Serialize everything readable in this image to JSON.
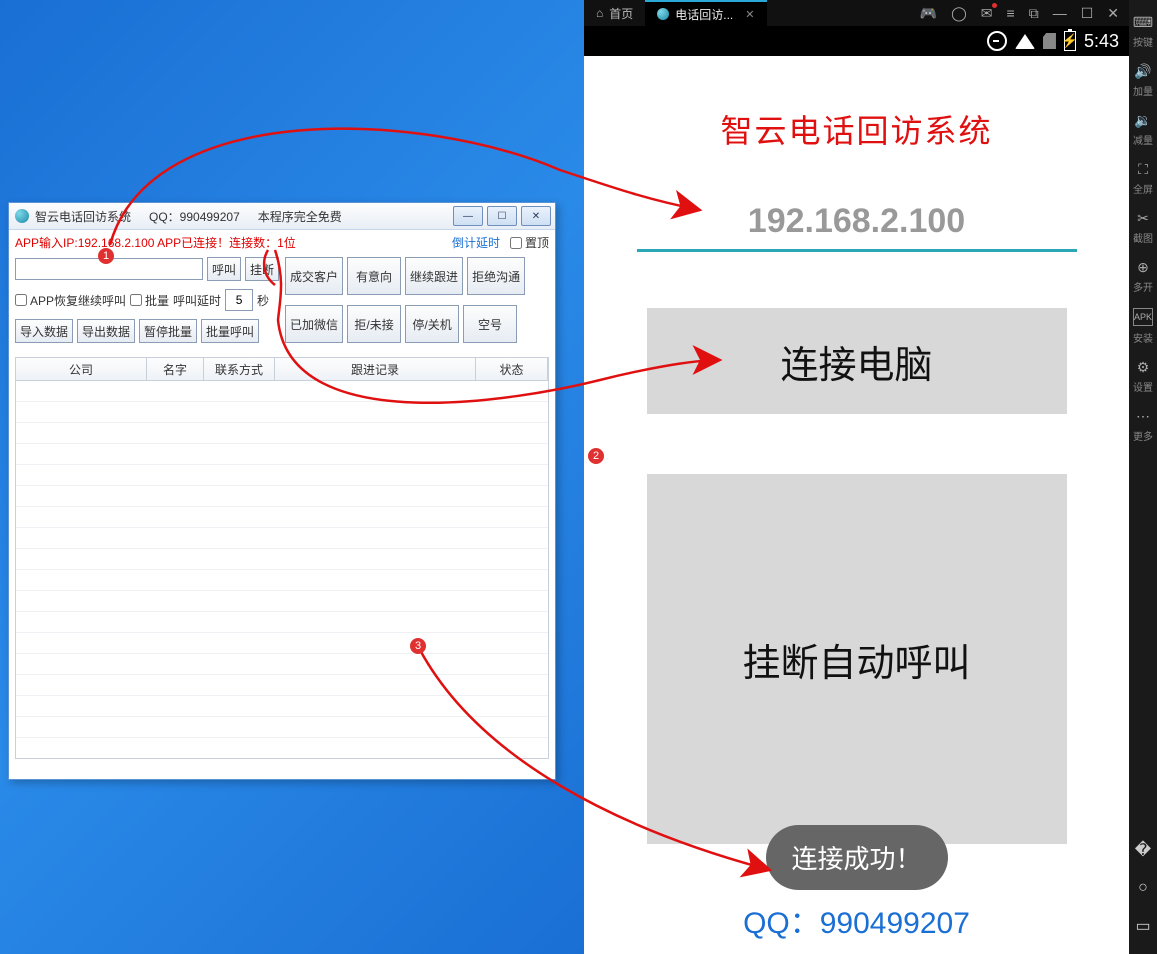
{
  "win": {
    "title_app": "智云电话回访系统",
    "title_qq": "QQ：990499207",
    "title_free": "本程序完全免费",
    "status_prefix": "APP输入IP:",
    "status_ip": "192.168.2.100",
    "status_connected": " APP已连接！连接数：",
    "status_count": "1位",
    "countdown": "倒计延时",
    "pin_top": "置顶",
    "btn_call": "呼叫",
    "btn_hang": "挂断",
    "chk_resume": "APP恢复继续呼叫",
    "chk_batch": "批量",
    "lbl_delay": "呼叫延时",
    "delay_val": "5",
    "lbl_sec": "秒",
    "btn_import": "导入数据",
    "btn_export": "导出数据",
    "btn_pause": "暂停批量",
    "btn_batchcall": "批量呼叫",
    "btn_deal": "成交客户",
    "btn_intent": "有意向",
    "btn_follow": "继续跟进",
    "btn_refuse": "拒绝沟通",
    "btn_wechat": "已加微信",
    "btn_miss": "拒/未接",
    "btn_off": "停/关机",
    "btn_empty": "空号",
    "cols": {
      "company": "公司",
      "name": "名字",
      "contact": "联系方式",
      "log": "跟进记录",
      "status": "状态"
    }
  },
  "emu": {
    "tab_home": "首页",
    "tab_app": "电话回访...",
    "time": "5:43",
    "app_title": "智云电话回访系统",
    "ip": "192.168.2.100",
    "btn_connect": "连接电脑",
    "btn_auto": "挂断自动呼叫",
    "toast": "连接成功！",
    "qq": "QQ：990499207"
  },
  "rtool": {
    "keys": "按键",
    "volup": "加量",
    "voldn": "减量",
    "full": "全屏",
    "shot": "截图",
    "multi": "多开",
    "apk": "安装",
    "set": "设置",
    "more": "更多"
  },
  "badges": {
    "b1": "1",
    "b2": "2",
    "b3": "3"
  }
}
